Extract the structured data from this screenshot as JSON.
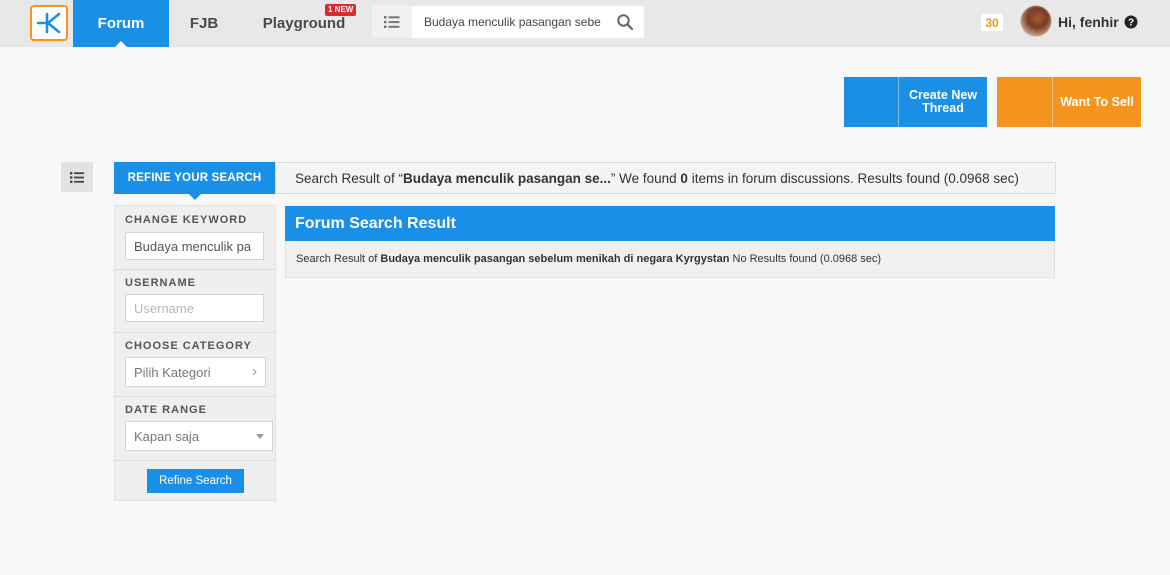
{
  "nav": {
    "forum": "Forum",
    "fjb": "FJB",
    "playground": "Playground",
    "new_badge": "1 NEW",
    "search_value": "Budaya menculik pasangan sebe",
    "notif_count": "30",
    "greeting": "Hi, fenhir"
  },
  "actions": {
    "create_line1": "Create New",
    "create_line2": "Thread",
    "sell": "Want To Sell"
  },
  "summary": {
    "refine_tab": "REFINE YOUR SEARCH",
    "prefix": "Search Result of “",
    "query": "Budaya menculik pasangan se...",
    "mid": "” We found ",
    "count": "0",
    "suffix": " items in forum discussions. Results found (0.0968 sec)"
  },
  "sidebar": {
    "keyword_title": "CHANGE KEYWORD",
    "keyword_value": "Budaya menculik pa",
    "username_title": "USERNAME",
    "username_placeholder": "Username",
    "category_title": "CHOOSE CATEGORY",
    "category_value": "Pilih Kategori",
    "date_title": "DATE RANGE",
    "date_value": "Kapan saja",
    "refine_button": "Refine Search"
  },
  "results": {
    "title": "Forum Search Result",
    "prefix": "Search Result of ",
    "query": "Budaya menculik pasangan sebelum menikah di negara Kyrgystan",
    "suffix": " No Results found (0.0968 sec)"
  },
  "colors": {
    "brand_blue": "#1a8fe8",
    "brand_orange": "#f7941e",
    "badge_red": "#e0282f"
  },
  "icons": {
    "logo": "kaskus-logo-icon",
    "menu": "list-icon",
    "search": "search-icon",
    "help": "question-circle-icon",
    "toggle": "list-icon"
  }
}
